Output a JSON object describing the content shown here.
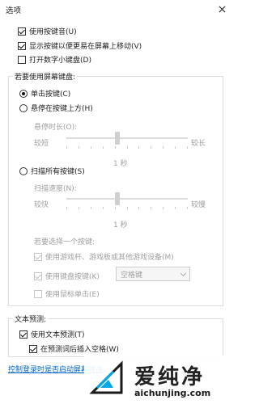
{
  "window": {
    "title": "选项"
  },
  "top_options": [
    {
      "label": "使用按键音(U)",
      "checked": true
    },
    {
      "label": "显示按键以便更易在屏幕上移动(V)",
      "checked": true
    },
    {
      "label": "打开数字小键盘(D)",
      "checked": false
    }
  ],
  "use_keys": {
    "legend": "若要使用屏幕键盘:",
    "click_label": "单击按键(C)",
    "hover_label": "悬停在按键上方(H)",
    "hover_duration_label": "悬停时长(O):",
    "hover_short": "较短",
    "hover_long": "较长",
    "hover_value": "1 秒",
    "hover_level": 0.42,
    "scan_label": "扫描所有按键(S)",
    "scan_speed_label": "扫描速度(N):",
    "scan_fast": "较快",
    "scan_slow": "较慢",
    "scan_value": "1 秒",
    "scan_level": 0.42,
    "select_key_label": "若要选择一个按键:",
    "gamepad_label": "使用游戏杆、游戏板或其他游戏设备(M)",
    "keyboard_key_label": "使用键盘按键(K)",
    "keyboard_key_value": "空格键",
    "mouse_click_label": "使用鼠标单击(E)"
  },
  "text_prediction": {
    "legend": "文本预测:",
    "use_label": "使用文本预测(T)",
    "space_label": "在预测词后插入空格(W)"
  },
  "link": {
    "label": "控制登录时是否启动屏幕键盘"
  },
  "watermark": {
    "brand": "爱纯净",
    "url": "aichunjing.com"
  },
  "colors": {
    "link": "#0066cc",
    "disabled": "#a0a0a0",
    "accent": "#00a8e8"
  }
}
